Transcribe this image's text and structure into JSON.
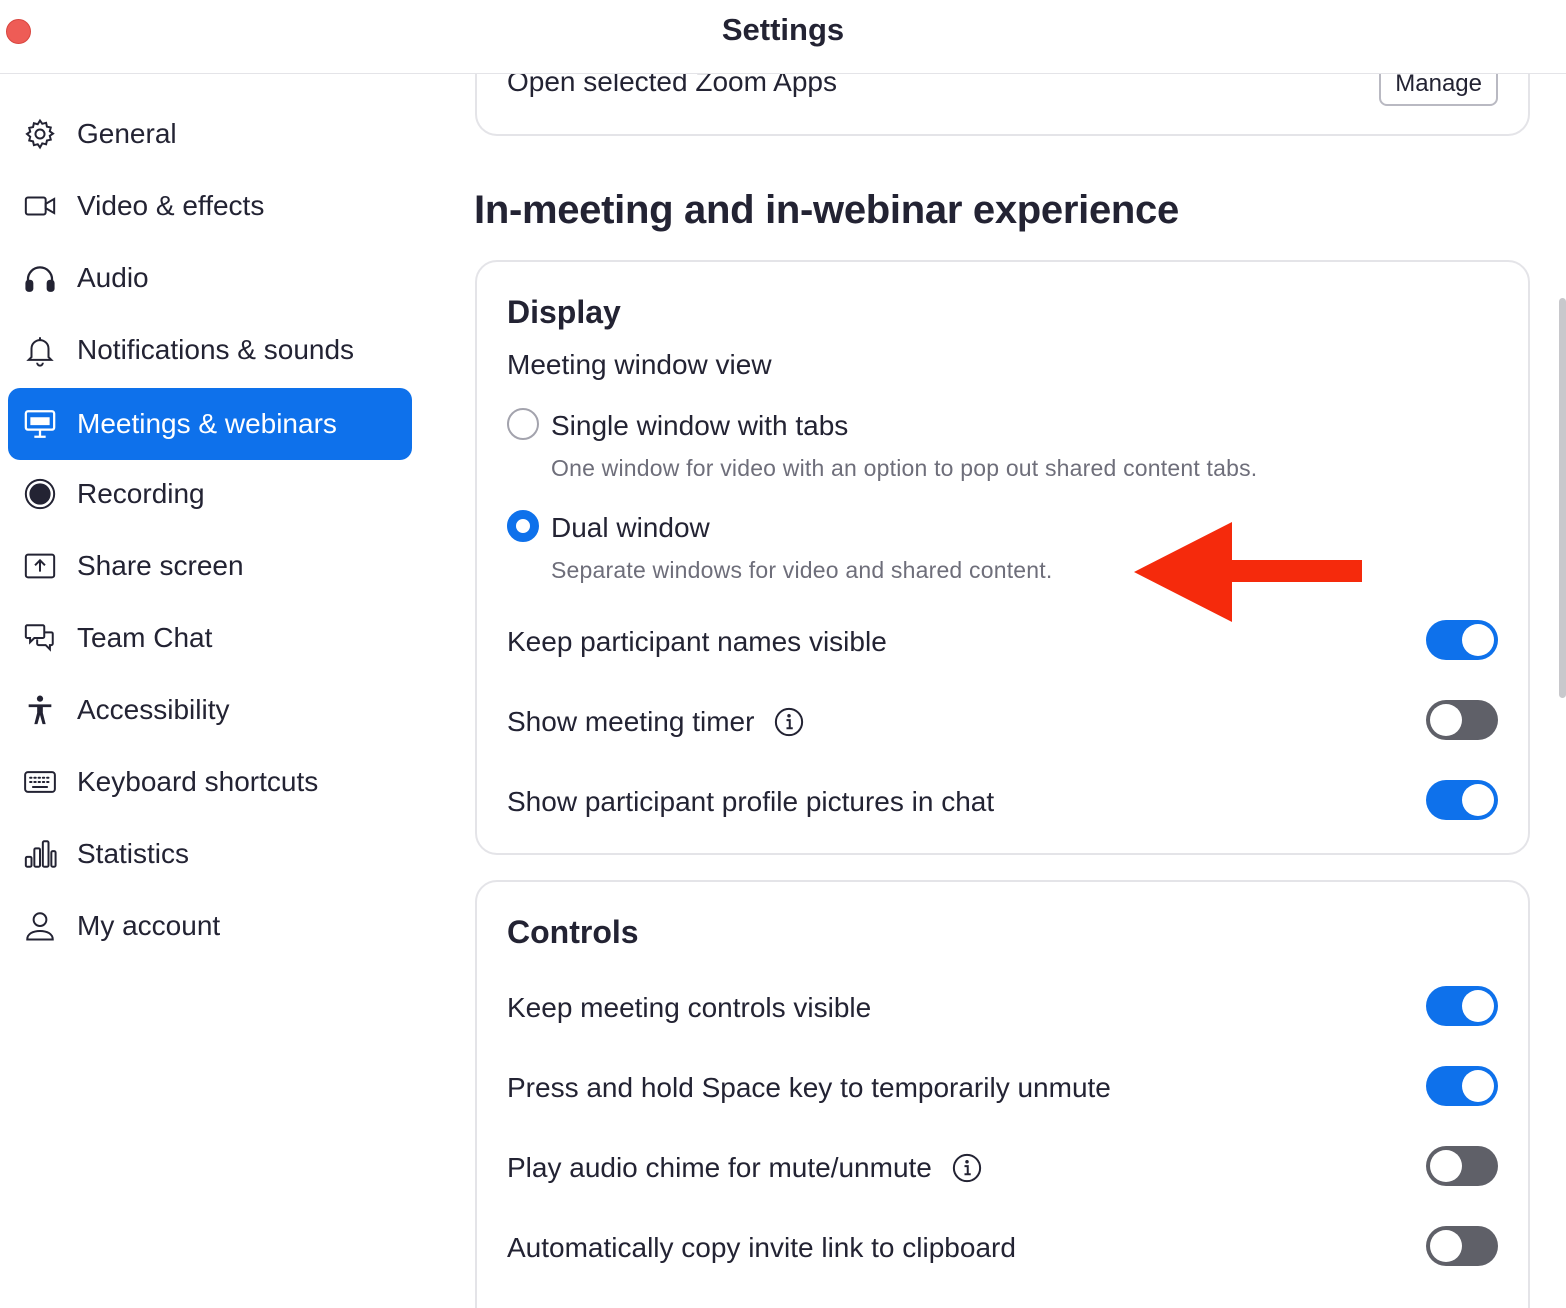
{
  "window": {
    "title": "Settings"
  },
  "sidebar": {
    "items": [
      {
        "label": "General",
        "icon": "gear-icon",
        "active": false
      },
      {
        "label": "Video & effects",
        "icon": "video-camera-icon",
        "active": false
      },
      {
        "label": "Audio",
        "icon": "headphones-icon",
        "active": false
      },
      {
        "label": "Notifications & sounds",
        "icon": "bell-icon",
        "active": false
      },
      {
        "label": "Meetings & webinars",
        "icon": "presentation-screen-icon",
        "active": true
      },
      {
        "label": "Recording",
        "icon": "record-icon",
        "active": false
      },
      {
        "label": "Share screen",
        "icon": "share-screen-icon",
        "active": false
      },
      {
        "label": "Team Chat",
        "icon": "chat-bubbles-icon",
        "active": false
      },
      {
        "label": "Accessibility",
        "icon": "accessibility-person-icon",
        "active": false
      },
      {
        "label": "Keyboard shortcuts",
        "icon": "keyboard-icon",
        "active": false
      },
      {
        "label": "Statistics",
        "icon": "bar-chart-icon",
        "active": false
      },
      {
        "label": "My account",
        "icon": "user-icon",
        "active": false
      }
    ]
  },
  "apps": {
    "label": "Open selected Zoom Apps",
    "manage_label": "Manage"
  },
  "section": {
    "heading": "In-meeting and in-webinar experience"
  },
  "display": {
    "title": "Display",
    "window_view_label": "Meeting window view",
    "options": [
      {
        "label": "Single window with tabs",
        "desc": "One window for video with an option to pop out shared content tabs.",
        "selected": false
      },
      {
        "label": "Dual window",
        "desc": "Separate windows for video and shared content.",
        "selected": true
      }
    ],
    "toggles": [
      {
        "label": "Keep participant names visible",
        "on": true,
        "info": false
      },
      {
        "label": "Show meeting timer",
        "on": false,
        "info": true
      },
      {
        "label": "Show participant profile pictures in chat",
        "on": true,
        "info": false
      }
    ]
  },
  "controls": {
    "title": "Controls",
    "toggles": [
      {
        "label": "Keep meeting controls visible",
        "on": true,
        "info": false
      },
      {
        "label": "Press and hold Space key to temporarily unmute",
        "on": true,
        "info": false
      },
      {
        "label": "Play audio chime for mute/unmute",
        "on": false,
        "info": true
      },
      {
        "label": "Automatically copy invite link to clipboard",
        "on": false,
        "info": false
      }
    ]
  },
  "colors": {
    "accent": "#0e71eb",
    "toggle_off": "#5f6068",
    "annotation_arrow": "#f52a0c",
    "close_button": "#ee5c56"
  }
}
